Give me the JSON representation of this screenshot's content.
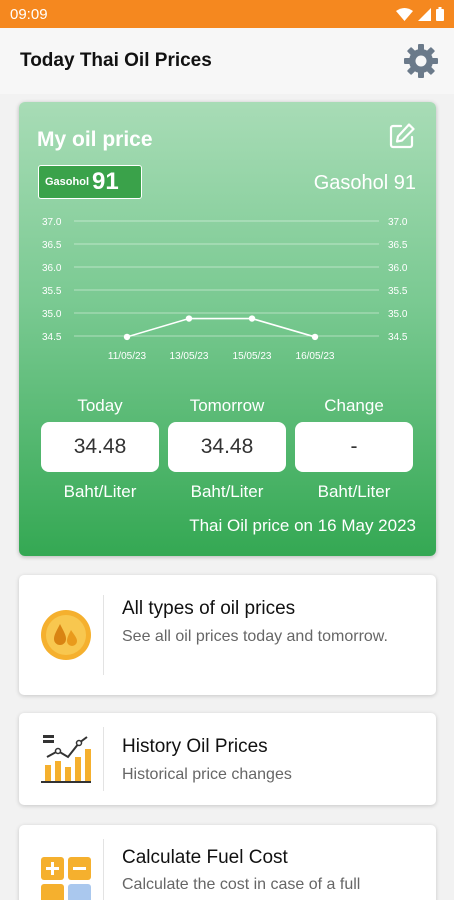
{
  "status": {
    "time": "09:09"
  },
  "appbar": {
    "title": "Today Thai Oil Prices"
  },
  "oil_card": {
    "heading": "My oil price",
    "logo_small": "Gasohol",
    "logo_big": "91",
    "fuel_name": "Gasohol 91",
    "columns": [
      {
        "label": "Today",
        "value": "34.48",
        "unit": "Baht/Liter"
      },
      {
        "label": "Tomorrow",
        "value": "34.48",
        "unit": "Baht/Liter"
      },
      {
        "label": "Change",
        "value": "-",
        "unit": "Baht/Liter"
      }
    ],
    "price_date": "Thai Oil price on 16 May 2023"
  },
  "chart_data": {
    "type": "line",
    "x": [
      "11/05/23",
      "13/05/23",
      "15/05/23",
      "16/05/23"
    ],
    "series": [
      {
        "values": [
          34.48,
          34.88,
          34.88,
          34.48
        ]
      }
    ],
    "y_ticks": [
      "37.0",
      "36.5",
      "36.0",
      "35.5",
      "35.0",
      "34.5"
    ],
    "ylim": [
      34.5,
      37.0
    ],
    "grid": true,
    "color": "#ffffff"
  },
  "menu": [
    {
      "title": "All types of oil prices",
      "desc": "See all oil prices today and tomorrow.",
      "icon": "oil-drops-icon"
    },
    {
      "title": "History Oil Prices",
      "desc": "Historical price changes",
      "icon": "history-chart-icon"
    },
    {
      "title": "Calculate Fuel Cost",
      "desc": "Calculate the cost in case of a full",
      "icon": "calculator-icon"
    }
  ],
  "colors": {
    "status_bar": "#f5881f",
    "card_green": "#34a853",
    "icon_orange": "#f5b02e"
  }
}
